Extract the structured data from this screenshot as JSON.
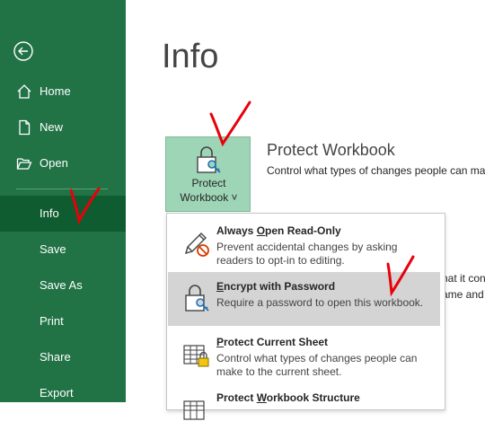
{
  "sidebar": {
    "items": [
      {
        "label": "Home",
        "icon": "home-icon"
      },
      {
        "label": "New",
        "icon": "new-document-icon"
      },
      {
        "label": "Open",
        "icon": "folder-open-icon"
      },
      {
        "label": "Info",
        "selected": true
      },
      {
        "label": "Save"
      },
      {
        "label": "Save As"
      },
      {
        "label": "Print"
      },
      {
        "label": "Share"
      },
      {
        "label": "Export"
      }
    ]
  },
  "main": {
    "title": "Info",
    "protect_button": {
      "line1": "Protect",
      "line2": "Workbook ˅"
    },
    "section_title": "Protect Workbook",
    "section_desc": "Control what types of changes people can ma",
    "bg_text1": "hat it con",
    "bg_text2": "ame and"
  },
  "dropdown": {
    "items": [
      {
        "title_pre": "Always ",
        "title_u": "O",
        "title_post": "pen Read-Only",
        "desc": "Prevent accidental changes by asking readers to opt-in to editing."
      },
      {
        "title_pre": "",
        "title_u": "E",
        "title_post": "ncrypt with Password",
        "desc": "Require a password to open this workbook.",
        "hovered": true
      },
      {
        "title_pre": "",
        "title_u": "P",
        "title_post": "rotect Current Sheet",
        "desc": "Control what types of changes people can make to the current sheet."
      },
      {
        "title_pre": "Protect ",
        "title_u": "W",
        "title_post": "orkbook Structure",
        "desc": ""
      }
    ]
  },
  "colors": {
    "sidebar": "#217346",
    "selected": "#0e5c2f",
    "annotation": "#e8000b"
  }
}
